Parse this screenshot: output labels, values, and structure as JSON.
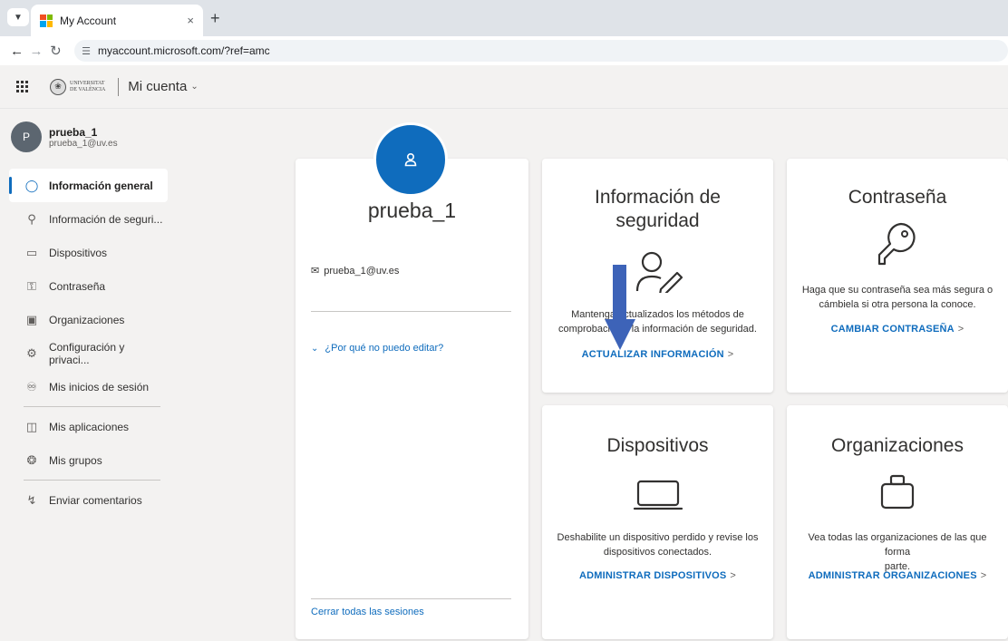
{
  "browser": {
    "tab_title": "My Account",
    "tab_menu_icon": "chevron-down-icon",
    "close_glyph": "×",
    "new_tab_glyph": "+",
    "url": "myaccount.microsoft.com/?ref=amc"
  },
  "header": {
    "logo_line1": "UNIVERSITAT",
    "logo_line2": "DE VALÈNCIA",
    "app_name": "Mi cuenta"
  },
  "profile": {
    "initial": "P",
    "name": "prueba_1",
    "email": "prueba_1@uv.es"
  },
  "sidebar": {
    "items": [
      {
        "label": "Información general",
        "icon": "person-icon",
        "active": true
      },
      {
        "label": "Información de seguri...",
        "icon": "person-key-icon"
      },
      {
        "label": "Dispositivos",
        "icon": "laptop-icon"
      },
      {
        "label": "Contraseña",
        "icon": "key-icon"
      },
      {
        "label": "Organizaciones",
        "icon": "briefcase-icon"
      },
      {
        "label": "Configuración y privaci...",
        "icon": "gear-icon"
      },
      {
        "label": "Mis inicios de sesión",
        "icon": "person-sync-icon"
      },
      {
        "label": "Mis aplicaciones",
        "icon": "apps-icon"
      },
      {
        "label": "Mis grupos",
        "icon": "people-icon"
      },
      {
        "label": "Enviar comentarios",
        "icon": "feedback-icon"
      }
    ]
  },
  "profile_card": {
    "name": "prueba_1",
    "email": "prueba_1@uv.es",
    "why_cant_edit": "¿Por qué no puedo editar?",
    "sign_out_all": "Cerrar todas las sesiones"
  },
  "cards": {
    "security": {
      "title_line1": "Información de",
      "title_line2": "seguridad",
      "desc_line1": "Mantenga actualizados los métodos de",
      "desc_line2": "comprobación y la información de seguridad.",
      "link": "ACTUALIZAR INFORMACIÓN",
      "icon": "person-pen-icon"
    },
    "password": {
      "title": "Contraseña",
      "desc_line1": "Haga que su contraseña sea más segura o",
      "desc_line2": "cámbiela si otra persona la conoce.",
      "link": "CAMBIAR CONTRASEÑA",
      "icon": "key-icon"
    },
    "devices": {
      "title": "Dispositivos",
      "desc_line1": "Deshabilite un dispositivo perdido y revise los",
      "desc_line2": "dispositivos conectados.",
      "link": "ADMINISTRAR DISPOSITIVOS",
      "icon": "laptop-icon"
    },
    "organizations": {
      "title": "Organizaciones",
      "desc_line1": "Vea todas las organizaciones de las que forma",
      "desc_line2": "parte.",
      "link": "ADMINISTRAR ORGANIZACIONES",
      "icon": "briefcase-icon"
    }
  },
  "link_arrow": ">",
  "colors": {
    "accent": "#0f6cbd",
    "annotation_arrow": "#3d63b8",
    "sidebar_bg": "#f3f2f1",
    "avatar_sm": "#5c6670"
  }
}
